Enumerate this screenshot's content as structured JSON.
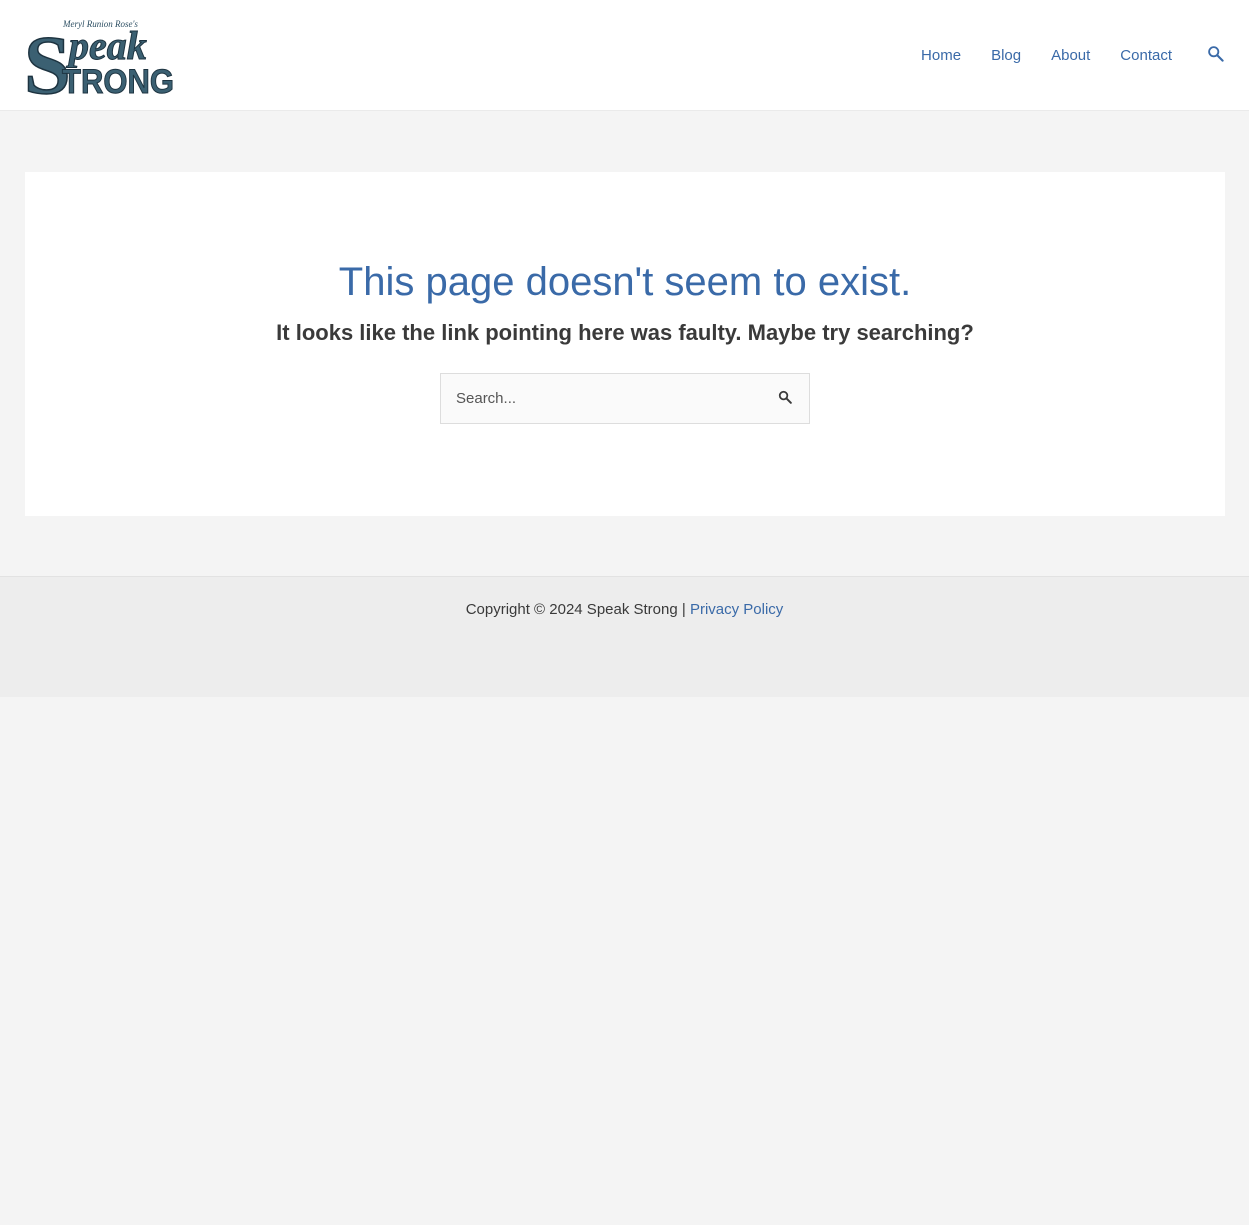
{
  "header": {
    "logo": {
      "small_text": "Meryl Runion Rose's",
      "word_big_s": "S",
      "word_peak": "peak",
      "word_trong": "TRONG",
      "alt": "Speak Strong"
    },
    "nav": [
      {
        "label": "Home"
      },
      {
        "label": "Blog"
      },
      {
        "label": "About"
      },
      {
        "label": "Contact"
      }
    ],
    "search_icon": "search-icon"
  },
  "main": {
    "title": "This page doesn't seem to exist.",
    "subtitle": "It looks like the link pointing here was faulty. Maybe try searching?",
    "search": {
      "placeholder": "Search...",
      "value": "",
      "submit_icon": "search-icon"
    }
  },
  "footer": {
    "copyright": "Copyright © 2024 Speak Strong |",
    "privacy_link": "Privacy Policy"
  },
  "colors": {
    "accent": "#3a6aa8",
    "logo": "#2d4f63",
    "text": "#3a3a3a",
    "page_bg": "#f4f4f4",
    "footer_bg": "#ededed"
  }
}
